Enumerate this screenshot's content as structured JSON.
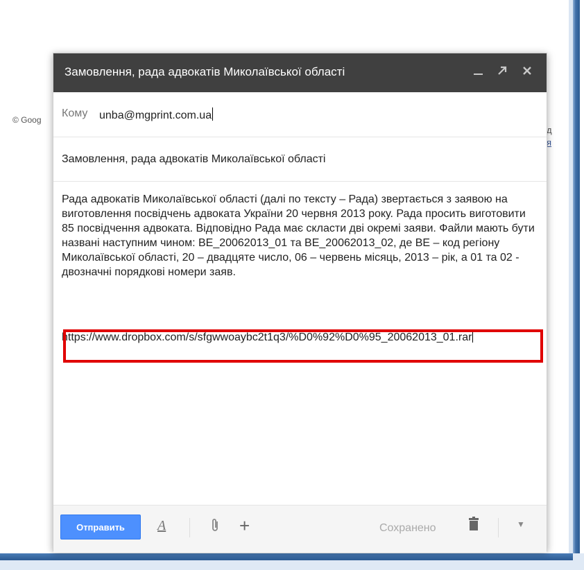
{
  "background": {
    "copyright": "© Goog",
    "edge_text_1": "д",
    "edge_text_2": "я"
  },
  "compose": {
    "title": "Замовлення, рада адвокатів Миколаївської області",
    "to_label": "Кому",
    "to_value": "unba@mgprint.com.ua",
    "subject": "Замовлення, рада адвокатів Миколаївської області",
    "body_text": "Рада адвокатів Миколаївської області (далі по тексту – Рада) звертається з заявою на виготовлення посвідчень адвоката України 20 червня 2013 року. Рада просить виготовити 85 посвідчення адвоката. Відповідно Рада має скласти дві окремі заяви. Файли мають бути названі наступним чином: BE_20062013_01 та BE_20062013_02, де BE – код регіону Миколаївської області, 20 – двадцяте число, 06 – червень місяць, 2013 – рік, а 01 та 02  - двозначні порядкові номери заяв.",
    "link_text": "https://www.dropbox.com/s/sfgwwoaybc2t1q3/%D0%92%D0%95_20062013_01.rar",
    "header_icons": [
      "minimize-icon",
      "popout-icon",
      "close-icon"
    ]
  },
  "toolbar": {
    "send_label": "Отправить",
    "saved_label": "Сохранено",
    "icons": [
      "format-text-icon",
      "attach-icon",
      "plus-icon",
      "trash-icon",
      "more-options-icon"
    ]
  },
  "colors": {
    "header_bg": "#404040",
    "send_button": "#4d90fe",
    "highlight_border": "#e00000",
    "window_frame": "#2b5a92"
  }
}
